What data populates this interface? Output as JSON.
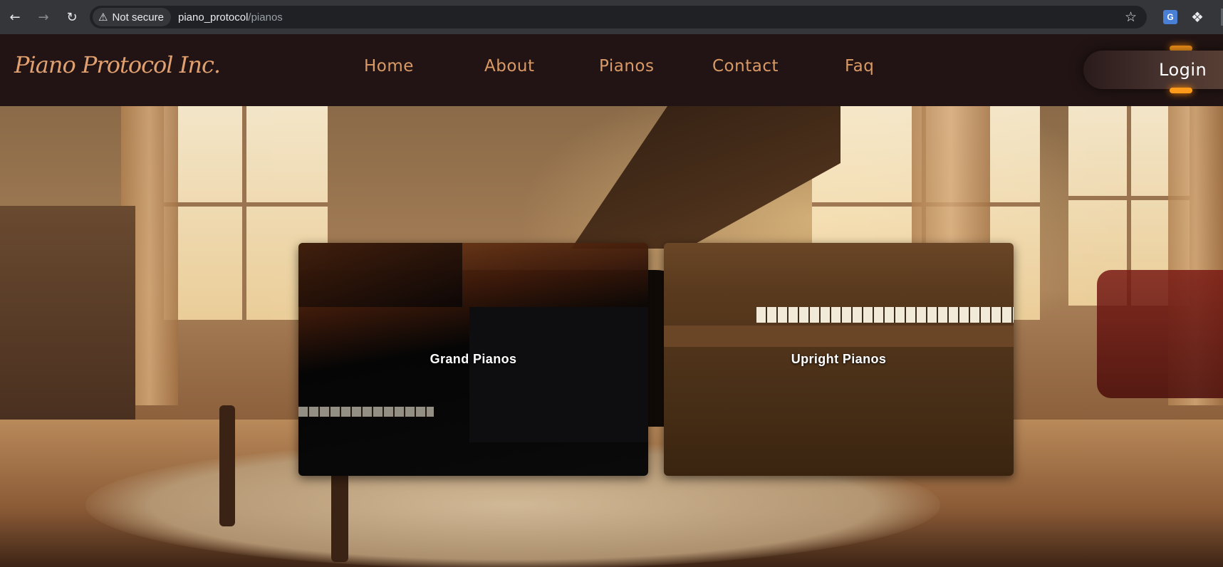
{
  "browser": {
    "security_label": "Not secure",
    "url_host": "piano_protocol",
    "url_path": "/pianos",
    "icons": [
      "back-icon",
      "forward-icon",
      "reload-icon",
      "warning-icon",
      "star-icon",
      "translate-icon",
      "extensions-icon"
    ]
  },
  "site": {
    "logo": "Piano Protocol Inc.",
    "nav": {
      "home": "Home",
      "about": "About",
      "pianos": "Pianos",
      "contact": "Contact",
      "faq": "Faq"
    },
    "login": "Login",
    "accent_color": "#d99a66"
  },
  "categories": {
    "grand": "Grand Pianos",
    "upright": "Upright Pianos"
  }
}
